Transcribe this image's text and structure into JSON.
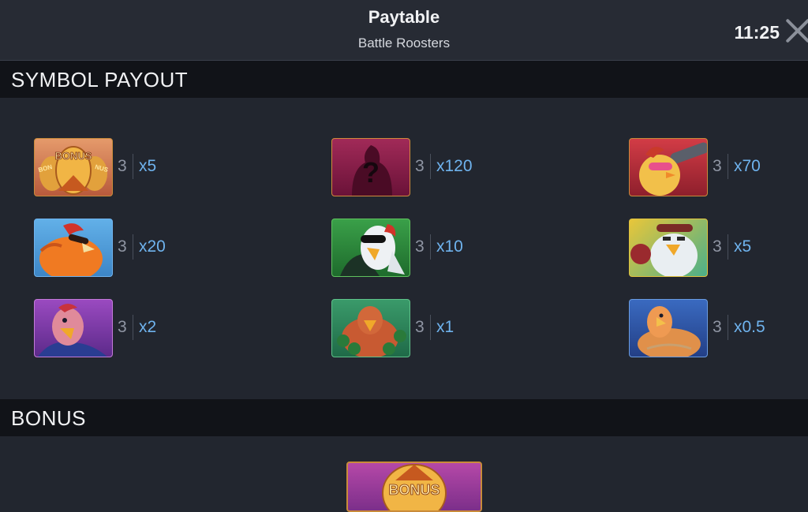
{
  "header": {
    "title": "Paytable",
    "subtitle": "Battle Roosters",
    "clock": "11:25"
  },
  "sections": {
    "symbol_payout": "SYMBOL PAYOUT",
    "bonus": "BONUS"
  },
  "symbols": [
    {
      "name": "bonus-symbol",
      "count": "3",
      "multiplier": "x5",
      "bg": "#d7835a",
      "border": "#c98b3a"
    },
    {
      "name": "mystery-symbol",
      "count": "3",
      "multiplier": "x120",
      "bg": "#8a1b4a",
      "border": "#d28a3c"
    },
    {
      "name": "rooster-sunglasses-symbol",
      "count": "3",
      "multiplier": "x70",
      "bg": "#c9333c",
      "border": "#c98b3a"
    },
    {
      "name": "rooster-orange-symbol",
      "count": "3",
      "multiplier": "x20",
      "bg": "#5ea9e0",
      "border": "#6fb3ee"
    },
    {
      "name": "rooster-ninja-symbol",
      "count": "3",
      "multiplier": "x10",
      "bg": "#2f8a3e",
      "border": "#5fc25e"
    },
    {
      "name": "rooster-boxer-symbol",
      "count": "3",
      "multiplier": "x5",
      "bg": "#b7c23a",
      "border": "#e0c23e"
    },
    {
      "name": "rooster-karate-symbol",
      "count": "3",
      "multiplier": "x2",
      "bg": "#8a3fb0",
      "border": "#c37ad8"
    },
    {
      "name": "rooster-sumo-symbol",
      "count": "3",
      "multiplier": "x1",
      "bg": "#2e8a62",
      "border": "#5fc28a"
    },
    {
      "name": "rooster-muscle-symbol",
      "count": "3",
      "multiplier": "x0.5",
      "bg": "#2f5aa8",
      "border": "#6a9be0"
    }
  ],
  "bonus_tile_text": "BONUS"
}
